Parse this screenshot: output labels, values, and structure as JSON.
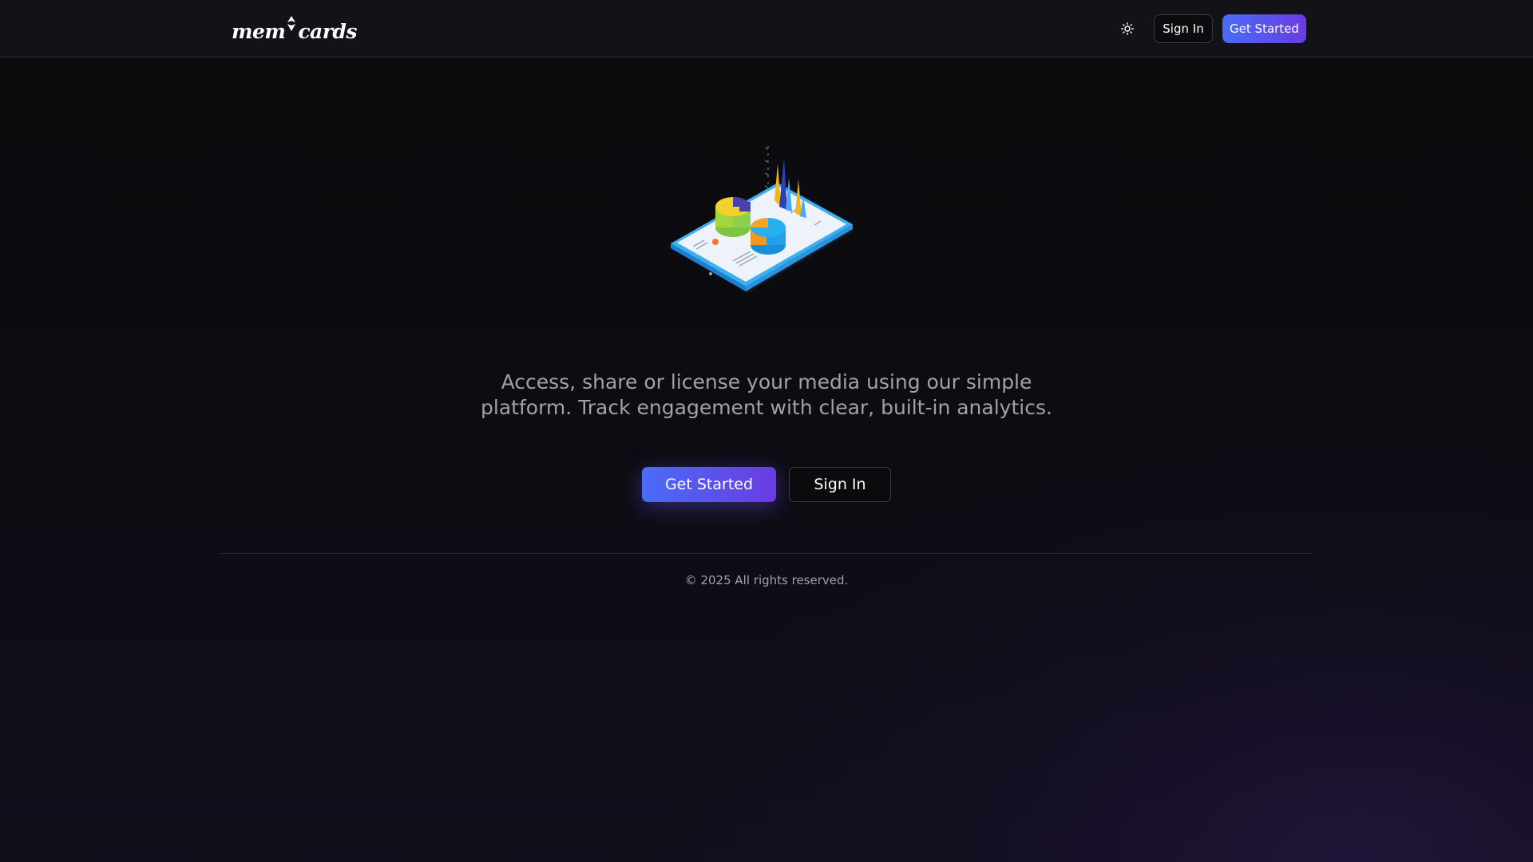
{
  "header": {
    "logo_left": "mem",
    "logo_right": "cards",
    "theme_toggle_icon": "sun-icon",
    "sign_in_label": "Sign In",
    "get_started_label": "Get Started"
  },
  "hero": {
    "illustration_icon": "analytics-tablet-illustration",
    "tagline": "Access, share or license your media using our simple platform. Track engagement with clear, built-in analytics.",
    "get_started_label": "Get Started",
    "sign_in_label": "Sign In"
  },
  "footer": {
    "copyright": "© 2025 All rights reserved."
  },
  "colors": {
    "accent_start": "#4a6cf7",
    "accent_end": "#6a3be4",
    "background": "#0b0b0d",
    "muted_text": "#a1a1aa"
  }
}
